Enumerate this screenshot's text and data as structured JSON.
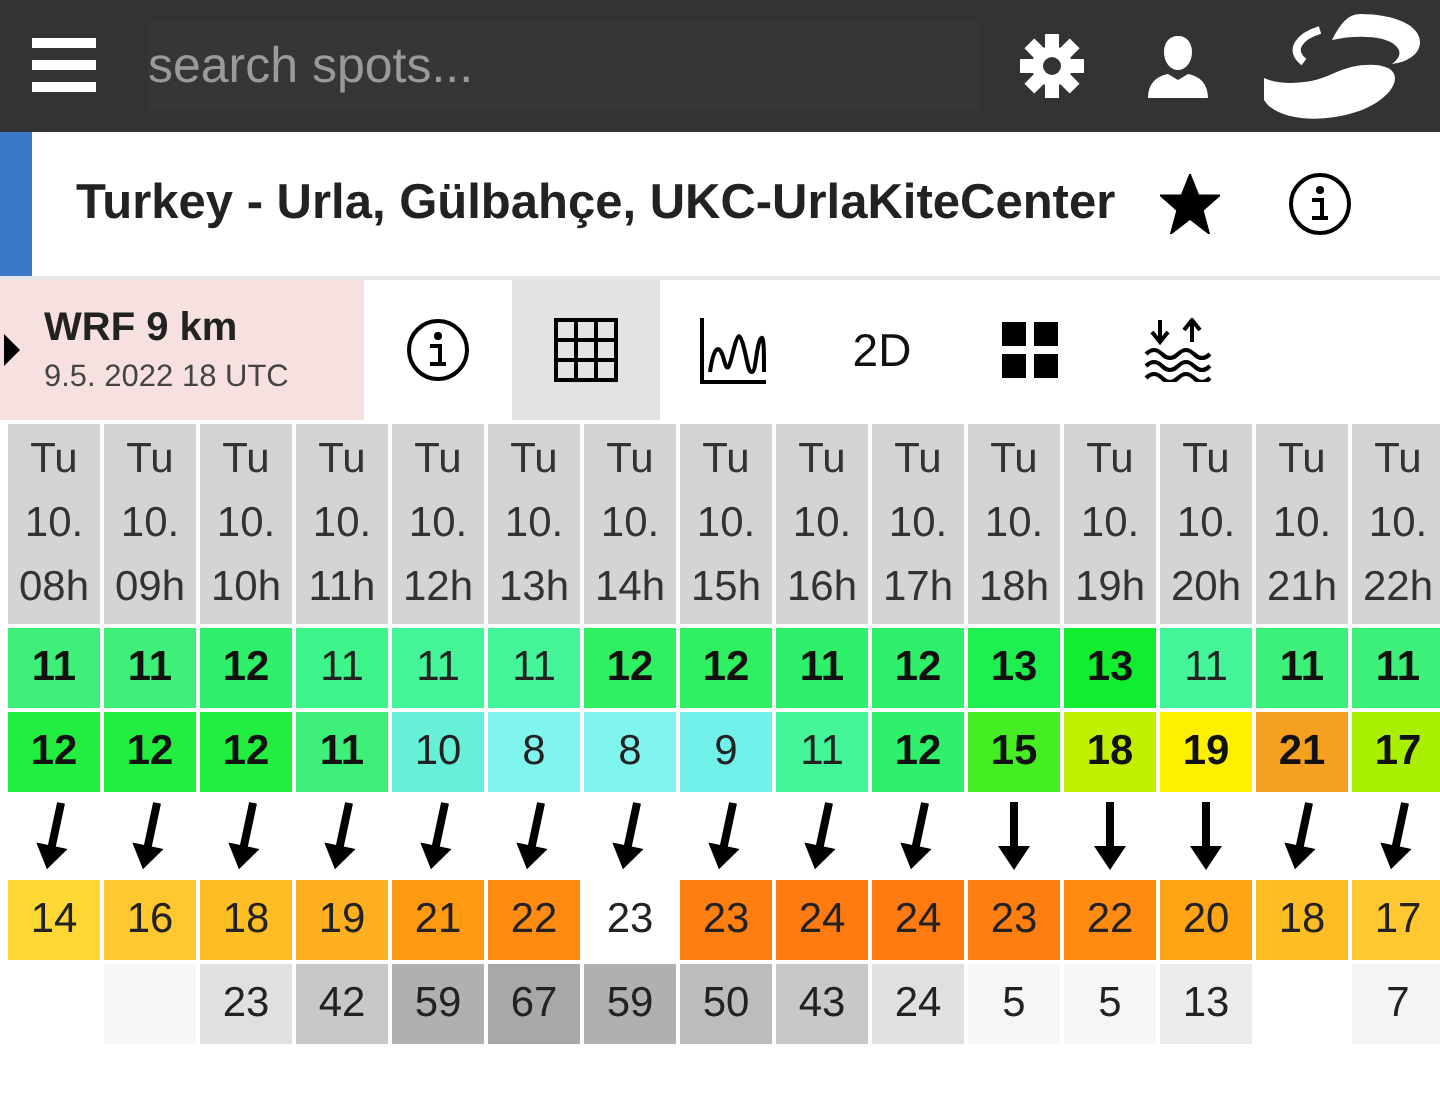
{
  "topbar": {
    "search": {
      "placeholder": "search spots..."
    }
  },
  "spot": {
    "title": "Turkey - Urla, Gülbahçe, UKC-UrlaKiteCenter",
    "favorite": true
  },
  "model": {
    "name": "WRF 9 km",
    "run": "9.5. 2022 18 UTC"
  },
  "views": [
    {
      "kind": "info",
      "selected": false
    },
    {
      "kind": "table",
      "selected": true
    },
    {
      "kind": "graph",
      "selected": false
    },
    {
      "kind": "text",
      "label": "2D",
      "selected": false
    },
    {
      "kind": "tiles",
      "selected": false
    },
    {
      "kind": "tide",
      "selected": false
    }
  ],
  "columns": [
    {
      "day": "Tu",
      "date": "10.",
      "hour": "08h",
      "wind": {
        "value": "11",
        "color": "#3ef07a",
        "bold": true
      },
      "gust": {
        "value": "12",
        "color": "#22ee40",
        "bold": true
      },
      "arrow": {
        "kind": "nne"
      },
      "temp": {
        "value": "14",
        "color": "#ffd835"
      }
    },
    {
      "day": "Tu",
      "date": "10.",
      "hour": "09h",
      "wind": {
        "value": "11",
        "color": "#3ef07a",
        "bold": true
      },
      "gust": {
        "value": "12",
        "color": "#22ee40",
        "bold": true
      },
      "arrow": {
        "kind": "nne"
      },
      "temp": {
        "value": "16",
        "color": "#ffc830"
      },
      "cloud": {
        "color": "#f6f6f6"
      }
    },
    {
      "day": "Tu",
      "date": "10.",
      "hour": "10h",
      "wind": {
        "value": "12",
        "color": "#2ef06a",
        "bold": true
      },
      "gust": {
        "value": "12",
        "color": "#22ee40",
        "bold": true
      },
      "arrow": {
        "kind": "nne"
      },
      "temp": {
        "value": "18",
        "color": "#ffbd25"
      },
      "cloud": {
        "value": "23",
        "color": "#e0e0e0"
      }
    },
    {
      "day": "Tu",
      "date": "10.",
      "hour": "11h",
      "wind": {
        "value": "11",
        "color": "#3df58a",
        "bold": false
      },
      "gust": {
        "value": "11",
        "color": "#3ef07a",
        "bold": true
      },
      "arrow": {
        "kind": "nne"
      },
      "temp": {
        "value": "19",
        "color": "#ffb020"
      },
      "cloud": {
        "value": "42",
        "color": "#c8c8c8"
      }
    },
    {
      "day": "Tu",
      "date": "10.",
      "hour": "12h",
      "wind": {
        "value": "11",
        "color": "#44f59a",
        "bold": false
      },
      "gust": {
        "value": "10",
        "color": "#66f0d8",
        "bold": false
      },
      "arrow": {
        "kind": "nne"
      },
      "temp": {
        "value": "21",
        "color": "#ff9a10"
      },
      "cloud": {
        "value": "59",
        "color": "#b0b0b0"
      }
    },
    {
      "day": "Tu",
      "date": "10.",
      "hour": "13h",
      "wind": {
        "value": "11",
        "color": "#44f59a",
        "bold": false
      },
      "gust": {
        "value": "8",
        "color": "#80f5ee",
        "bold": false
      },
      "arrow": {
        "kind": "nne"
      },
      "temp": {
        "value": "22",
        "color": "#ff8c10"
      },
      "cloud": {
        "value": "67",
        "color": "#a8a8a8"
      }
    },
    {
      "day": "Tu",
      "date": "10.",
      "hour": "14h",
      "wind": {
        "value": "12",
        "color": "#2ef060",
        "bold": true
      },
      "gust": {
        "value": "8",
        "color": "#80f5ee",
        "bold": false
      },
      "arrow": {
        "kind": "nne"
      },
      "temp": {
        "value": "23",
        "color": "#ffffff"
      },
      "cloud": {
        "value": "59",
        "color": "#b0b0b0"
      }
    },
    {
      "day": "Tu",
      "date": "10.",
      "hour": "15h",
      "wind": {
        "value": "12",
        "color": "#2ef060",
        "bold": true
      },
      "gust": {
        "value": "9",
        "color": "#70f0e8",
        "bold": false
      },
      "arrow": {
        "kind": "nne"
      },
      "temp": {
        "value": "23",
        "color": "#ff7e10"
      },
      "cloud": {
        "value": "50",
        "color": "#bcbcbc"
      }
    },
    {
      "day": "Tu",
      "date": "10.",
      "hour": "16h",
      "wind": {
        "value": "11",
        "color": "#2ef06a",
        "bold": true
      },
      "gust": {
        "value": "11",
        "color": "#44f59a",
        "bold": false
      },
      "arrow": {
        "kind": "nne"
      },
      "temp": {
        "value": "24",
        "color": "#ff7a10"
      },
      "cloud": {
        "value": "43",
        "color": "#c8c8c8"
      }
    },
    {
      "day": "Tu",
      "date": "10.",
      "hour": "17h",
      "wind": {
        "value": "12",
        "color": "#2ef06a",
        "bold": true
      },
      "gust": {
        "value": "12",
        "color": "#2ef06a",
        "bold": true
      },
      "arrow": {
        "kind": "nne"
      },
      "temp": {
        "value": "24",
        "color": "#ff7a10"
      },
      "cloud": {
        "value": "24",
        "color": "#e0e0e0"
      }
    },
    {
      "day": "Tu",
      "date": "10.",
      "hour": "18h",
      "wind": {
        "value": "13",
        "color": "#1ef050",
        "bold": true
      },
      "gust": {
        "value": "15",
        "color": "#44ee22",
        "bold": true
      },
      "arrow": {
        "kind": "n"
      },
      "temp": {
        "value": "23",
        "color": "#ff7e10"
      },
      "cloud": {
        "value": "5",
        "color": "#f6f6f6"
      }
    },
    {
      "day": "Tu",
      "date": "10.",
      "hour": "19h",
      "wind": {
        "value": "13",
        "color": "#11ee30",
        "bold": true
      },
      "gust": {
        "value": "18",
        "color": "#c0f000",
        "bold": true
      },
      "arrow": {
        "kind": "n"
      },
      "temp": {
        "value": "22",
        "color": "#ff8c10"
      },
      "cloud": {
        "value": "5",
        "color": "#f6f6f6"
      }
    },
    {
      "day": "Tu",
      "date": "10.",
      "hour": "20h",
      "wind": {
        "value": "11",
        "color": "#44f59a",
        "bold": false
      },
      "gust": {
        "value": "19",
        "color": "#fff000",
        "bold": true
      },
      "arrow": {
        "kind": "n"
      },
      "temp": {
        "value": "20",
        "color": "#ffa515"
      },
      "cloud": {
        "value": "13",
        "color": "#ececec"
      }
    },
    {
      "day": "Tu",
      "date": "10.",
      "hour": "21h",
      "wind": {
        "value": "11",
        "color": "#3df07a",
        "bold": true
      },
      "gust": {
        "value": "21",
        "color": "#f5a020",
        "bold": true
      },
      "arrow": {
        "kind": "nne"
      },
      "temp": {
        "value": "18",
        "color": "#ffbd25"
      }
    },
    {
      "day": "Tu",
      "date": "10.",
      "hour": "22h",
      "wind": {
        "value": "11",
        "color": "#3df07a",
        "bold": true
      },
      "gust": {
        "value": "17",
        "color": "#a8f000",
        "bold": true
      },
      "arrow": {
        "kind": "nne"
      },
      "temp": {
        "value": "17",
        "color": "#ffc830"
      },
      "cloud": {
        "value": "7",
        "color": "#f4f4f4"
      }
    }
  ]
}
